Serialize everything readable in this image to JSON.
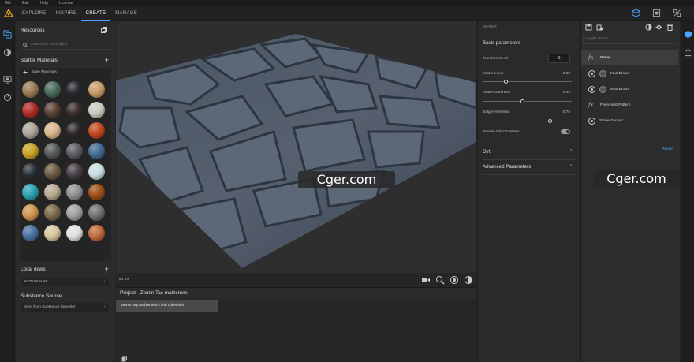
{
  "menubar": [
    "File",
    "Edit",
    "Help",
    "License"
  ],
  "nav": {
    "tabs": [
      "EXPLORE",
      "INSPIRE",
      "CREATE",
      "MANAGE"
    ],
    "active": "CREATE"
  },
  "resources": {
    "title": "Resources",
    "search_placeholder": "Search for material(s)",
    "starter_title": "Starter Materials",
    "crumb": "Base Materials",
    "materials": [
      "#9a7a55",
      "#4a6a5a",
      "#2a2a33",
      "#c89a6a",
      "#b02a25",
      "#5a4035",
      "#3a2e2a",
      "#c9c9c0",
      "#aaa498",
      "#d8b58a",
      "#2f2a2a",
      "#c0481f",
      "#c7a023",
      "#555a58",
      "#5a5d62",
      "#3f6a93",
      "#283038",
      "#6a5a40",
      "#4a4048",
      "#c8dce0",
      "#2aa0b0",
      "#b8a890",
      "#8f8f8f",
      "#a04d18",
      "#d0924f",
      "#7a6a48",
      "#a0a0a0",
      "#707070",
      "#4870a0",
      "#d6c6a0",
      "#e0e0e0",
      "#c06a3c"
    ],
    "local_title": "Local disks",
    "local_item": "KUTUPHANE",
    "source_title": "Substance Source",
    "source_item": "Sent from Substance launcher"
  },
  "viewport": {
    "render_time": "64 ms"
  },
  "project": {
    "title": "Project - Zemin Taş malzemesi",
    "item": "Zemin Taş malzemesi's first collection"
  },
  "params": {
    "header": "WATER",
    "basic_title": "Basic parameters",
    "random_seed_label": "Random Seed",
    "random_seed": "0",
    "water_level_label": "Water Level",
    "water_level": "0.23",
    "water_darkness_label": "Water Darkness",
    "water_darkness": "0.43",
    "edges_wetness_label": "Edges Wetness",
    "edges_wetness": "0.75",
    "dirt_on_water_label": "Enable Dirt On Water",
    "dirt_title": "Dirt",
    "advanced_title": "Advanced Parameters"
  },
  "layers": {
    "graph_placeholder": "Height Blend",
    "items": [
      "Water",
      "Mud Brown",
      "Mud Brown",
      "Pavement Pattern",
      "Stone Generic"
    ],
    "reload": "Reload"
  },
  "watermarks": [
    "Cger.com",
    "Cger.com"
  ]
}
